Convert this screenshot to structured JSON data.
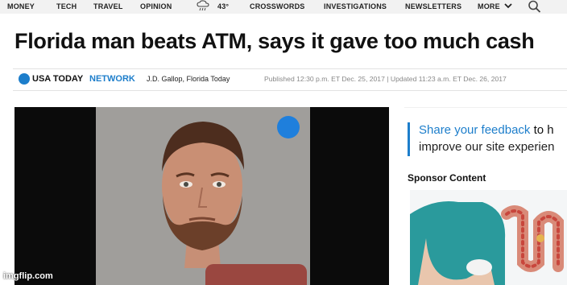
{
  "nav": {
    "items": [
      "MONEY",
      "TECH",
      "TRAVEL",
      "OPINION"
    ],
    "weather_temp": "43°",
    "items_right": [
      "CROSSWORDS",
      "INVESTIGATIONS",
      "NEWSLETTERS",
      "MORE"
    ],
    "weather_icon": "cloud-rain-icon",
    "search_icon": "search-icon"
  },
  "article": {
    "headline": "Florida man beats ATM, says it gave too much cash",
    "brand_a": "USA TODAY",
    "brand_b": "NETWORK",
    "author": "J.D. Gallop, Florida Today",
    "published": "Published 12:30 p.m. ET Dec. 25, 2017 | Updated 11:23 a.m. ET Dec. 26, 2017"
  },
  "sidebar": {
    "feedback_link": "Share your feedback",
    "feedback_rest": " to h",
    "feedback_line2": "improve our site experien",
    "sponsor_label": "Sponsor Content"
  },
  "watermark": "imgflip.com",
  "colors": {
    "accent": "#1d7ecb",
    "nav_bg": "#f2f2f2"
  }
}
